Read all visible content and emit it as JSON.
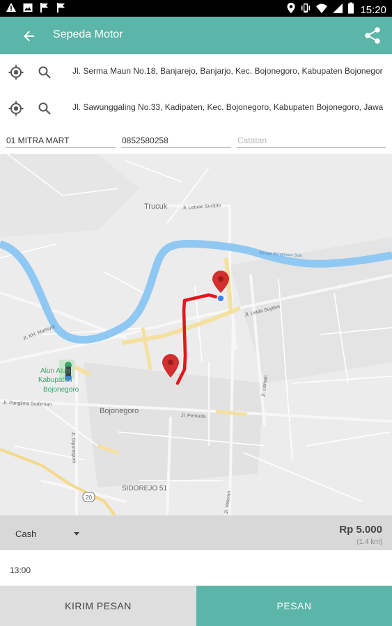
{
  "status_bar": {
    "time": "15:20",
    "left_icons": [
      "warning-icon",
      "gallery-icon",
      "flag-icon",
      "flag-icon"
    ],
    "right_icons": [
      "location-icon",
      "vibrate-icon",
      "wifi-icon",
      "signal-icon",
      "battery-icon"
    ]
  },
  "app_bar": {
    "title": "Sepeda Motor",
    "color": "#5bb5a8"
  },
  "pickup": {
    "address": "Jl. Serma Maun No.18, Banjarejo, Banjarjo, Kec. Bojonegoro, Kabupaten Bojonegoro"
  },
  "destination": {
    "address": "Jl. Sawunggaling No.33, Kadipaten, Kec. Bojonegoro, Kabupaten Bojonegoro, Jawa Timur"
  },
  "form": {
    "name": "01 MITRA MART",
    "phone": "0852580258",
    "note_placeholder": "Catatan"
  },
  "map": {
    "labels": {
      "trucuk": "Trucuk",
      "letnan_sucipto": "Jl. Letnan Sucipto",
      "sungai": "Sungai Bengawan Solo",
      "letda_suyitno": "Jl. Letda Suyitno",
      "kh_mansyur": "Jl. KH. Mansyur",
      "alun": "Alun Alun",
      "kabupaten": "Kabupaten",
      "bojonegoro_place": "Bojonegoro",
      "panglima": "Jl. Panglima Sudirman",
      "bojonegoro_city": "Bojonegoro",
      "pemuda": "Jl. Pemuda",
      "lisman": "Jl. Lisman",
      "diponegoro": "Jl. Diponegoro",
      "sidorejo": "SIDOREJO 51",
      "veteran": "Jl. Veteran",
      "route_number": "20"
    },
    "route_color": "#e8141b",
    "river_color": "#8fc8f2"
  },
  "payment": {
    "method": "Cash",
    "price": "Rp 5.000",
    "distance": "(1.4 km)"
  },
  "time": {
    "value": "13:00"
  },
  "buttons": {
    "send_message": "KIRIM PESAN",
    "order": "PESAN"
  }
}
